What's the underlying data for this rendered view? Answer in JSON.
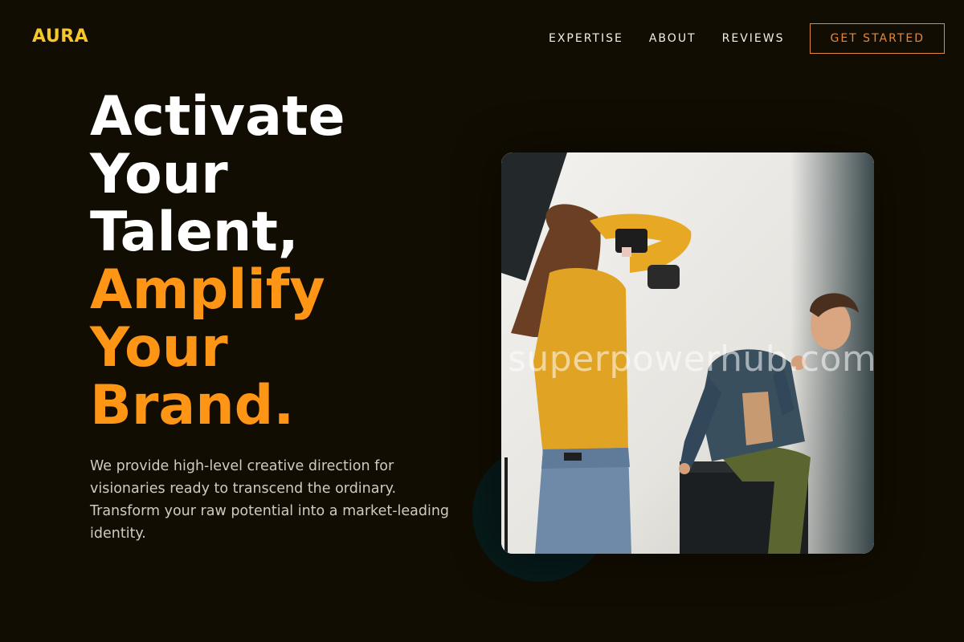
{
  "brand": {
    "name": "AURA"
  },
  "nav": {
    "links": [
      "EXPERTISE",
      "ABOUT",
      "REVIEWS"
    ],
    "cta_label": "GET STARTED"
  },
  "hero": {
    "headline_white": [
      "Activate",
      "Your",
      "Talent,"
    ],
    "headline_orange": [
      "Amplify",
      "Your",
      "Brand."
    ],
    "description": "We provide high-level creative direction for visionaries ready to transcend the ordinary. Transform your raw potential into a market-leading identity.",
    "image_watermark": "superpowerhub.com"
  },
  "colors": {
    "background": "#120d02",
    "brand": "#f5c72a",
    "accent": "#ff9514",
    "cta_border": "#e08a3e"
  }
}
